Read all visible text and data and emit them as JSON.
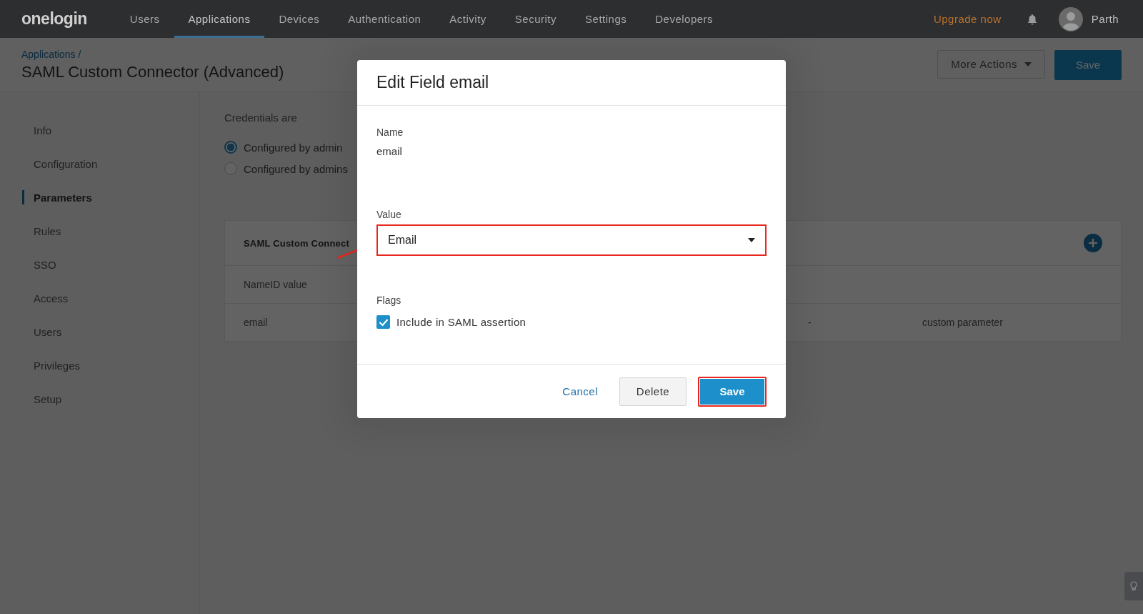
{
  "topbar": {
    "logo": "onelogin",
    "nav": [
      {
        "label": "Users",
        "selected": false
      },
      {
        "label": "Applications",
        "selected": true
      },
      {
        "label": "Devices",
        "selected": false
      },
      {
        "label": "Authentication",
        "selected": false
      },
      {
        "label": "Activity",
        "selected": false
      },
      {
        "label": "Security",
        "selected": false
      },
      {
        "label": "Settings",
        "selected": false
      },
      {
        "label": "Developers",
        "selected": false
      }
    ],
    "upgrade": "Upgrade now",
    "user": "Parth"
  },
  "header": {
    "breadcrumb": "Applications /",
    "title": "SAML Custom Connector (Advanced)",
    "more_actions": "More Actions",
    "save": "Save"
  },
  "sidebar": {
    "items": [
      {
        "label": "Info",
        "selected": false
      },
      {
        "label": "Configuration",
        "selected": false
      },
      {
        "label": "Parameters",
        "selected": true
      },
      {
        "label": "Rules",
        "selected": false
      },
      {
        "label": "SSO",
        "selected": false
      },
      {
        "label": "Access",
        "selected": false
      },
      {
        "label": "Users",
        "selected": false
      },
      {
        "label": "Privileges",
        "selected": false
      },
      {
        "label": "Setup",
        "selected": false
      }
    ]
  },
  "credentials": {
    "label": "Credentials are",
    "options": [
      {
        "label": "Configured by admin",
        "selected": true
      },
      {
        "label": "Configured by admins",
        "selected": false
      }
    ]
  },
  "table": {
    "title": "SAML Custom Connect",
    "rows": [
      [
        "NameID value",
        "",
        ""
      ],
      [
        "email",
        "-",
        "custom parameter"
      ]
    ]
  },
  "dialog": {
    "title": "Edit Field email",
    "name_label": "Name",
    "name_value": "email",
    "value_label": "Value",
    "value": "Email",
    "value_highlighted": true,
    "flags_label": "Flags",
    "flags": [
      {
        "label": "Include in SAML assertion",
        "checked": true
      }
    ],
    "cancel": "Cancel",
    "delete": "Delete",
    "save": "Save",
    "save_highlighted": true
  }
}
